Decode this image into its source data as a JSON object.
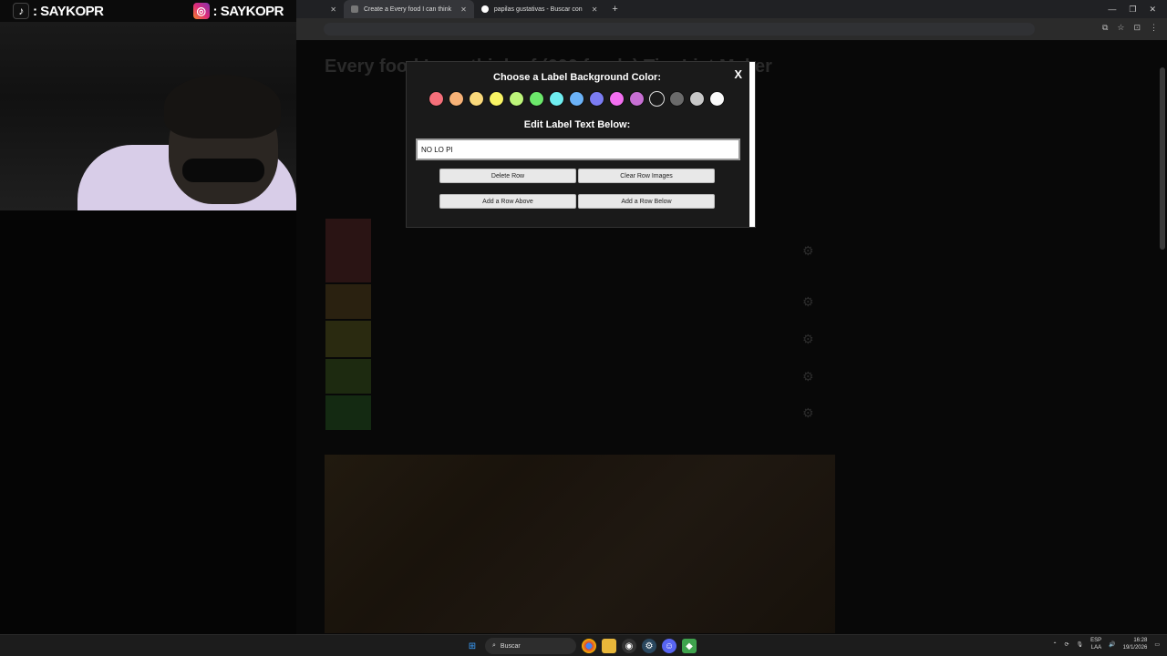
{
  "overlay": {
    "tiktok_handle": ": SAYKOPR",
    "instagram_handle": ": SAYKOPR"
  },
  "browser": {
    "tabs": [
      {
        "label": "Create a Every food I can think",
        "active": true
      },
      {
        "label": "papilas gustativas - Buscar con",
        "active": false
      }
    ],
    "new_tab": "+",
    "window_controls": [
      "—",
      "❐",
      "✕"
    ]
  },
  "page": {
    "title": "Every food I can think of (600 foods) Tier List Maker"
  },
  "modal": {
    "close_label": "X",
    "color_heading": "Choose a Label Background Color:",
    "text_heading": "Edit Label Text Below:",
    "label_text_value": "NO LO PI",
    "swatch_colors": [
      "#f56f7a",
      "#f7b277",
      "#fad97b",
      "#f9f464",
      "#bdf57a",
      "#6ce86b",
      "#6feef0",
      "#6bb2f7",
      "#7b7cf2",
      "#f36ff0",
      "#c76fd3",
      "#1a1a1a",
      "#6a6a6a",
      "#c8c8c8",
      "#fafafa"
    ],
    "buttons": {
      "delete_row": "Delete Row",
      "clear_row_images": "Clear Row Images",
      "add_row_above": "Add a Row Above",
      "add_row_below": "Add a Row Below"
    }
  },
  "taskbar": {
    "search_label": "Buscar",
    "lang_top": "ESP",
    "lang_bottom": "LAA",
    "time": "16:28",
    "date": "19/1/2026"
  }
}
